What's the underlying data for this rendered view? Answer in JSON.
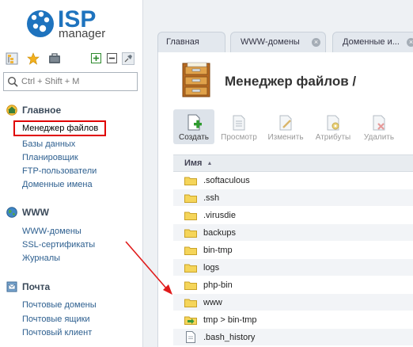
{
  "logo": {
    "brand": "ISP",
    "product": "manager"
  },
  "search": {
    "placeholder": "Ctrl + Shift + M"
  },
  "sidebar": {
    "sections": [
      {
        "title": "Главное",
        "items": [
          "Менеджер файлов",
          "Базы данных",
          "Планировщик",
          "FTP-пользователи",
          "Доменные имена"
        ]
      },
      {
        "title": "WWW",
        "items": [
          "WWW-домены",
          "SSL-сертификаты",
          "Журналы"
        ]
      },
      {
        "title": "Почта",
        "items": [
          "Почтовые домены",
          "Почтовые ящики",
          "Почтовый клиент"
        ]
      }
    ],
    "active_item": "Менеджер файлов"
  },
  "tabs": [
    "Главная",
    "WWW-домены",
    "Доменные и..."
  ],
  "page": {
    "title": "Менеджер файлов /"
  },
  "actions": [
    "Создать",
    "Просмотр",
    "Изменить",
    "Атрибуты",
    "Удалить"
  ],
  "table": {
    "column_header": "Имя",
    "sort_indicator": "▲",
    "rows": [
      {
        "name": ".softaculous",
        "type": "folder"
      },
      {
        "name": ".ssh",
        "type": "folder"
      },
      {
        "name": ".virusdie",
        "type": "folder"
      },
      {
        "name": "backups",
        "type": "folder"
      },
      {
        "name": "bin-tmp",
        "type": "folder"
      },
      {
        "name": "logs",
        "type": "folder"
      },
      {
        "name": "php-bin",
        "type": "folder"
      },
      {
        "name": "www",
        "type": "folder"
      },
      {
        "name": "tmp > bin-tmp",
        "type": "symlink"
      },
      {
        "name": ".bash_history",
        "type": "file"
      }
    ]
  },
  "colors": {
    "accent": "#1e73be",
    "highlight": "#e00000",
    "folder": "#f5d55a"
  }
}
